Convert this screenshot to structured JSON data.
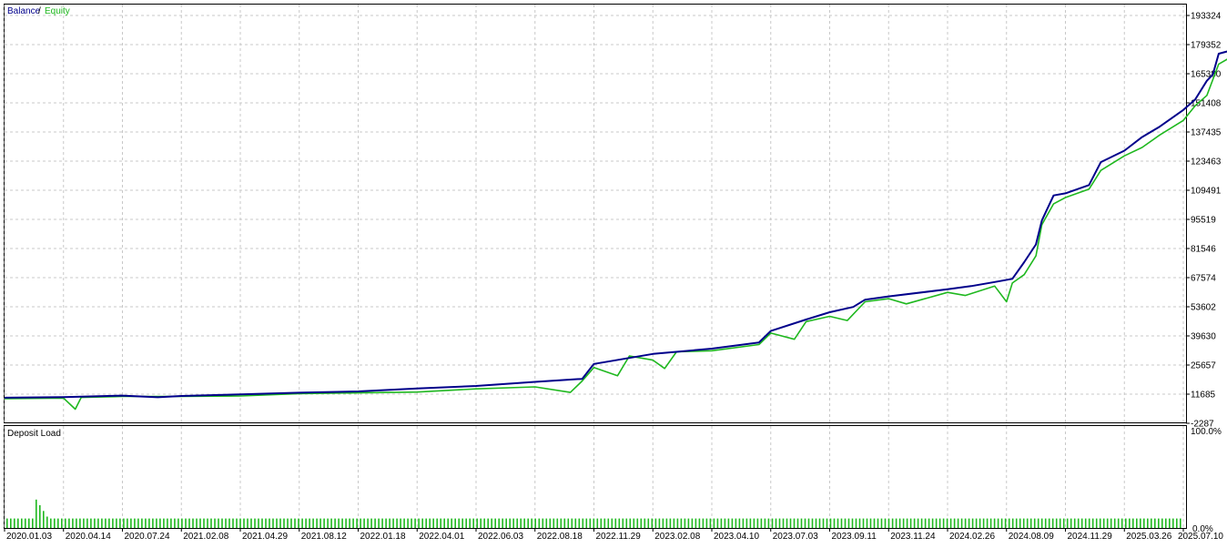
{
  "legend": {
    "balance_label": "Balance",
    "separator": "/",
    "equity_label": "Equity",
    "balance_color": "#00008b",
    "equity_color": "#1fb81f"
  },
  "load_panel": {
    "title": "Deposit Load",
    "top_label": "100.0%",
    "bottom_label": "0.0%",
    "bar_color": "#1fb81f"
  },
  "chart_data": [
    {
      "type": "line",
      "xlabel": "",
      "ylabel": "",
      "ylim": [
        -2287,
        193324
      ],
      "yticks": [
        193324,
        179352,
        165380,
        151408,
        137435,
        123463,
        109491,
        95519,
        81546,
        67574,
        53602,
        39630,
        25657,
        11685,
        -2287
      ],
      "ytick_labels": [
        "193324",
        "179352",
        "165380",
        "151408",
        "137435",
        "123463",
        "109491",
        "95519",
        "81546",
        "67574",
        "53602",
        "39630",
        "25657",
        "11685",
        "-2287"
      ],
      "xtick_labels": [
        "2020.01.03",
        "2020.04.14",
        "2020.07.24",
        "2021.02.08",
        "2021.04.29",
        "2021.08.12",
        "2022.01.18",
        "2022.04.01",
        "2022.06.03",
        "2022.08.18",
        "2022.11.29",
        "2023.02.08",
        "2023.04.10",
        "2023.07.03",
        "2023.09.11",
        "2023.11.24",
        "2024.02.26",
        "2024.08.09",
        "2024.11.29",
        "2025.03.26",
        "2025.07.10"
      ],
      "grid": true,
      "series": [
        {
          "name": "Balance",
          "color": "#00008b",
          "points": [
            [
              0,
              10000
            ],
            [
              1,
              10300
            ],
            [
              2,
              11000
            ],
            [
              2.6,
              10200
            ],
            [
              3,
              10800
            ],
            [
              4,
              11600
            ],
            [
              5,
              12400
            ],
            [
              6,
              13000
            ],
            [
              7,
              14400
            ],
            [
              8,
              15600
            ],
            [
              9,
              17600
            ],
            [
              9.8,
              19000
            ],
            [
              10,
              26200
            ],
            [
              11,
              31000
            ],
            [
              12,
              33500
            ],
            [
              12.8,
              36500
            ],
            [
              13,
              42000
            ],
            [
              13.6,
              47500
            ],
            [
              14,
              51000
            ],
            [
              14.4,
              53500
            ],
            [
              14.6,
              57000
            ],
            [
              15,
              58600
            ],
            [
              16,
              62000
            ],
            [
              16.4,
              63500
            ],
            [
              16.8,
              65500
            ],
            [
              17.1,
              67000
            ],
            [
              17.3,
              75000
            ],
            [
              17.5,
              83500
            ],
            [
              17.6,
              95000
            ],
            [
              17.8,
              107000
            ],
            [
              18,
              108000
            ],
            [
              18.4,
              112000
            ],
            [
              18.6,
              123000
            ],
            [
              19,
              128500
            ],
            [
              19.3,
              135000
            ],
            [
              19.6,
              140000
            ],
            [
              20,
              148000
            ],
            [
              20.2,
              153000
            ],
            [
              20.4,
              162000
            ],
            [
              20.5,
              165000
            ],
            [
              20.6,
              175000
            ],
            [
              21,
              178000
            ]
          ]
        },
        {
          "name": "Equity",
          "color": "#1fb81f",
          "points": [
            [
              0,
              9500
            ],
            [
              1,
              9800
            ],
            [
              1.2,
              4500
            ],
            [
              1.3,
              10100
            ],
            [
              2,
              10600
            ],
            [
              3,
              10600
            ],
            [
              4,
              10800
            ],
            [
              5,
              11900
            ],
            [
              6,
              12300
            ],
            [
              7,
              12700
            ],
            [
              8,
              14200
            ],
            [
              9,
              15200
            ],
            [
              9.6,
              12500
            ],
            [
              9.8,
              18000
            ],
            [
              10,
              24500
            ],
            [
              10.4,
              20500
            ],
            [
              10.6,
              30000
            ],
            [
              11,
              28000
            ],
            [
              11.2,
              24000
            ],
            [
              11.4,
              32000
            ],
            [
              12,
              32500
            ],
            [
              12.8,
              35500
            ],
            [
              13,
              41000
            ],
            [
              13.4,
              38000
            ],
            [
              13.6,
              46500
            ],
            [
              14,
              49000
            ],
            [
              14.3,
              47000
            ],
            [
              14.6,
              56000
            ],
            [
              15,
              57500
            ],
            [
              15.3,
              55000
            ],
            [
              16,
              60500
            ],
            [
              16.3,
              59000
            ],
            [
              16.8,
              63500
            ],
            [
              17,
              56000
            ],
            [
              17.1,
              65000
            ],
            [
              17.3,
              69000
            ],
            [
              17.5,
              78000
            ],
            [
              17.6,
              93000
            ],
            [
              17.8,
              103000
            ],
            [
              18,
              106000
            ],
            [
              18.4,
              110000
            ],
            [
              18.6,
              119000
            ],
            [
              19,
              126000
            ],
            [
              19.3,
              130000
            ],
            [
              19.6,
              136000
            ],
            [
              20,
              143000
            ],
            [
              20.2,
              150000
            ],
            [
              20.4,
              155000
            ],
            [
              20.6,
              170000
            ],
            [
              21,
              176500
            ]
          ]
        }
      ]
    },
    {
      "type": "bar",
      "title": "Deposit Load",
      "ylim": [
        0,
        100
      ],
      "series": [
        {
          "name": "Deposit Load",
          "values": [
            10,
            10,
            10,
            10,
            10,
            10,
            10,
            10,
            30,
            24,
            18,
            12,
            10,
            10,
            10,
            10,
            10,
            10,
            10,
            10,
            10,
            10,
            10,
            10,
            10,
            10,
            10,
            10,
            10,
            10,
            10,
            10,
            10,
            10,
            10,
            10,
            10,
            10,
            10,
            10,
            10,
            10,
            10,
            10,
            10,
            10,
            10,
            10,
            10,
            10,
            10,
            10,
            10,
            10,
            10,
            10,
            10,
            10,
            10,
            10,
            10,
            10,
            10,
            10,
            10,
            10,
            10,
            10,
            10,
            10,
            10,
            10,
            10,
            10,
            10,
            10,
            10,
            10,
            10,
            10,
            10,
            10,
            10,
            10,
            10,
            10,
            10,
            10,
            10,
            10,
            10,
            10,
            10,
            10,
            10,
            10,
            10,
            10,
            10,
            10,
            10,
            10,
            10,
            10,
            10,
            10,
            10,
            10,
            10,
            10,
            10,
            10,
            10,
            10,
            10,
            10,
            10,
            10,
            10,
            10,
            10,
            10,
            10,
            10,
            10,
            10,
            10,
            10,
            10,
            10,
            10,
            10,
            10,
            10,
            10,
            10,
            10,
            10,
            10,
            10,
            10,
            10,
            10,
            10,
            10,
            10,
            10,
            10,
            10,
            10,
            10,
            10,
            10,
            10,
            10,
            10,
            10,
            10,
            10,
            10,
            10,
            10,
            10,
            10,
            10,
            10,
            10,
            10,
            10,
            10,
            10,
            10,
            10,
            10,
            10,
            10,
            10,
            10,
            10,
            10,
            10,
            10,
            10,
            10,
            10,
            10,
            10,
            10,
            10,
            10,
            10,
            10,
            10,
            10,
            10,
            10,
            10,
            10,
            10,
            10,
            10,
            10,
            10,
            10,
            10,
            10,
            10,
            10,
            10,
            10,
            10,
            10,
            10,
            10,
            10,
            10,
            10,
            10,
            10,
            10,
            10,
            10,
            10,
            10,
            10,
            10,
            10,
            10,
            10,
            10,
            10,
            10,
            10,
            10,
            10,
            10,
            10,
            10,
            10,
            10,
            10,
            10,
            10,
            10,
            10,
            10,
            10,
            10,
            10,
            10,
            10,
            10,
            10,
            10,
            10,
            10,
            10,
            10,
            10,
            10,
            10,
            10,
            10,
            10,
            10,
            10,
            10,
            10,
            10,
            10,
            10,
            10,
            10,
            10,
            10,
            10,
            10,
            10,
            10,
            10,
            10,
            10,
            10,
            10,
            10,
            10,
            10,
            10,
            10,
            10,
            10,
            10,
            10,
            10,
            10,
            10,
            10,
            10,
            10,
            10,
            10,
            10,
            10,
            10,
            10,
            10,
            10,
            10,
            10,
            10,
            10,
            10,
            10,
            10,
            10,
            10,
            10,
            10,
            10,
            10,
            10,
            10,
            10
          ]
        }
      ]
    }
  ]
}
